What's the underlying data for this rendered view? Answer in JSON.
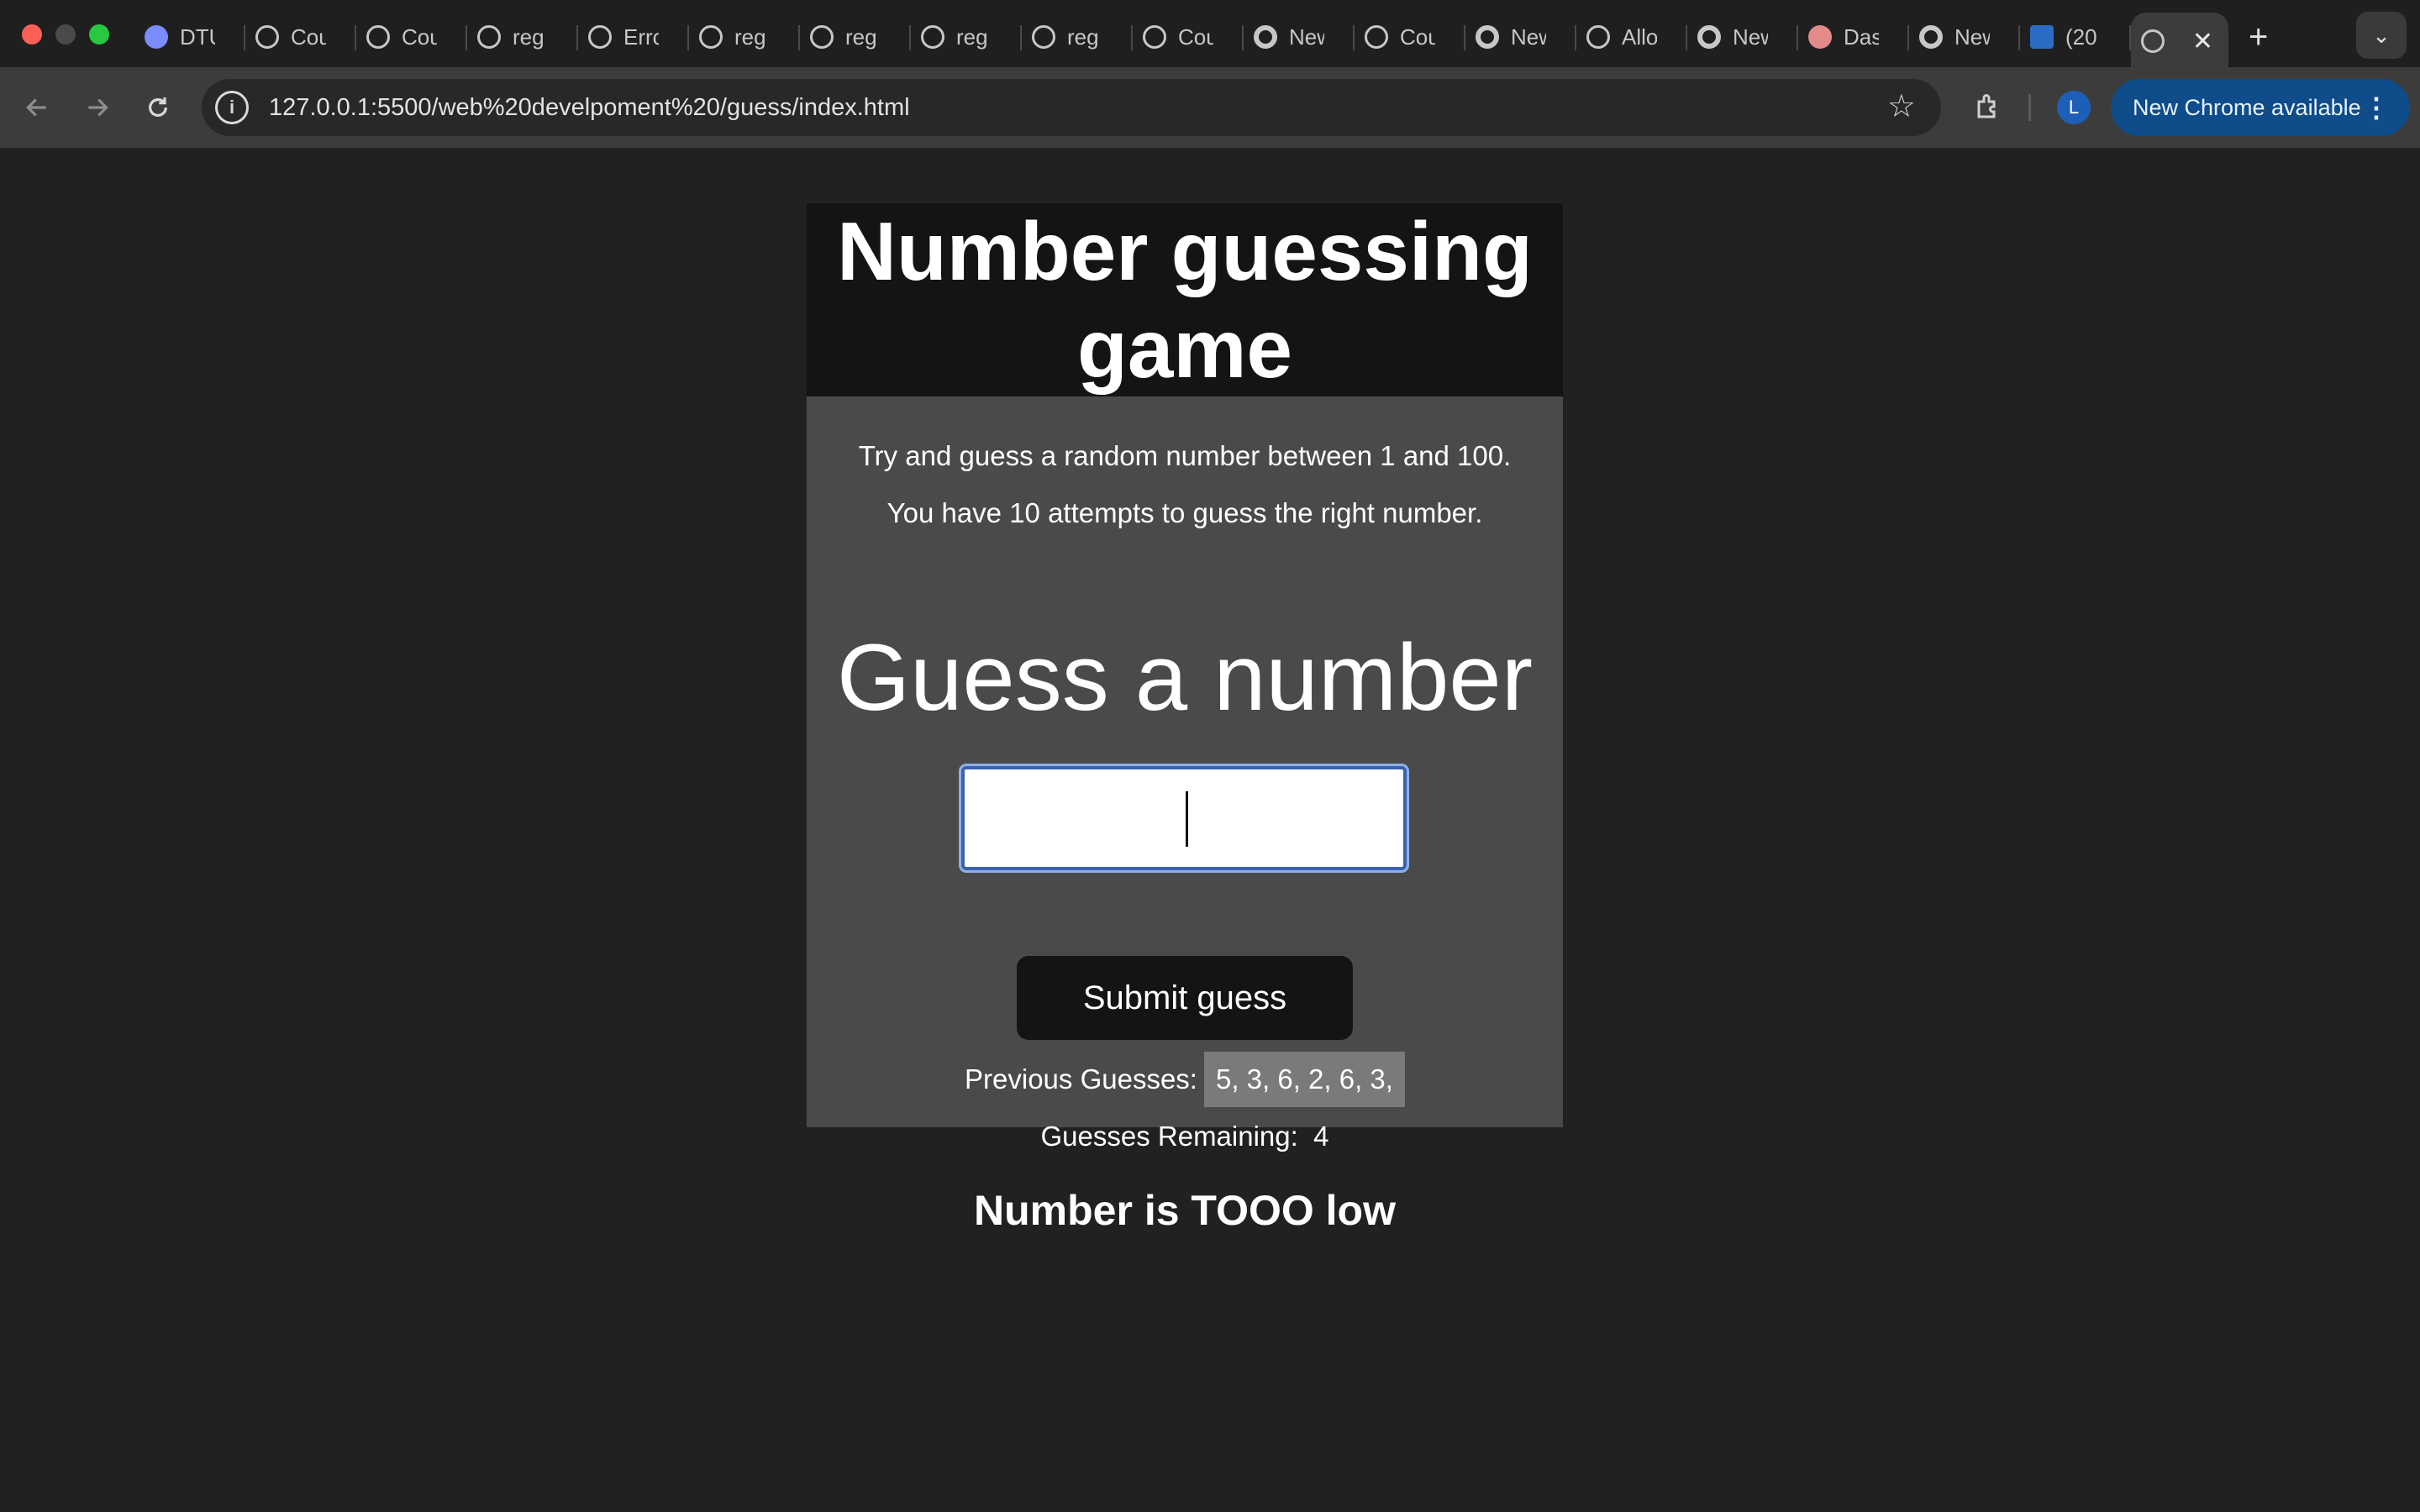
{
  "browser": {
    "tabs": [
      {
        "title": "DTU",
        "icon": "target-icon",
        "color": "#7b8cff"
      },
      {
        "title": "Cou",
        "icon": "globe-icon",
        "color": "#c7c7c7"
      },
      {
        "title": "Cou",
        "icon": "globe-icon",
        "color": "#c7c7c7"
      },
      {
        "title": "reg",
        "icon": "globe-icon",
        "color": "#c7c7c7"
      },
      {
        "title": "Erro",
        "icon": "globe-icon",
        "color": "#c7c7c7"
      },
      {
        "title": "reg",
        "icon": "globe-icon",
        "color": "#c7c7c7"
      },
      {
        "title": "reg",
        "icon": "globe-icon",
        "color": "#c7c7c7"
      },
      {
        "title": "reg",
        "icon": "globe-icon",
        "color": "#c7c7c7"
      },
      {
        "title": "reg",
        "icon": "globe-icon",
        "color": "#c7c7c7"
      },
      {
        "title": "Cou",
        "icon": "globe-icon",
        "color": "#c7c7c7"
      },
      {
        "title": "New",
        "icon": "chrome-icon",
        "color": "#c7c7c7"
      },
      {
        "title": "Cou",
        "icon": "globe-icon",
        "color": "#c7c7c7"
      },
      {
        "title": "New",
        "icon": "chrome-icon",
        "color": "#c7c7c7"
      },
      {
        "title": "Allo",
        "icon": "globe-icon",
        "color": "#c7c7c7"
      },
      {
        "title": "New",
        "icon": "chrome-icon",
        "color": "#c7c7c7"
      },
      {
        "title": "Das",
        "icon": "dashboard-icon",
        "color": "#e58a8a"
      },
      {
        "title": "New",
        "icon": "chrome-icon",
        "color": "#c7c7c7"
      },
      {
        "title": "(20",
        "icon": "linkedin-icon",
        "color": "#2b6cc4"
      }
    ],
    "active_tab_close": "✕",
    "new_tab": "+",
    "tab_menu": "⌄",
    "url": "127.0.0.1:5500/web%20develpoment%20/guess/index.html",
    "profile_initial": "L",
    "update_label": "New Chrome available"
  },
  "game": {
    "title": "Number guessing game",
    "intro_line_1": "Try and guess a random number between 1 and 100.",
    "intro_line_2": "You have 10 attempts to guess the right number.",
    "guess_label": "Guess a number",
    "input_value": "",
    "submit_label": "Submit guess",
    "previous_label": "Previous Guesses:",
    "previous_values": "5, 3, 6, 2, 6, 3,",
    "remaining_label": "Guesses Remaining:",
    "remaining_value": "4",
    "message": "Number is TOOO low"
  }
}
